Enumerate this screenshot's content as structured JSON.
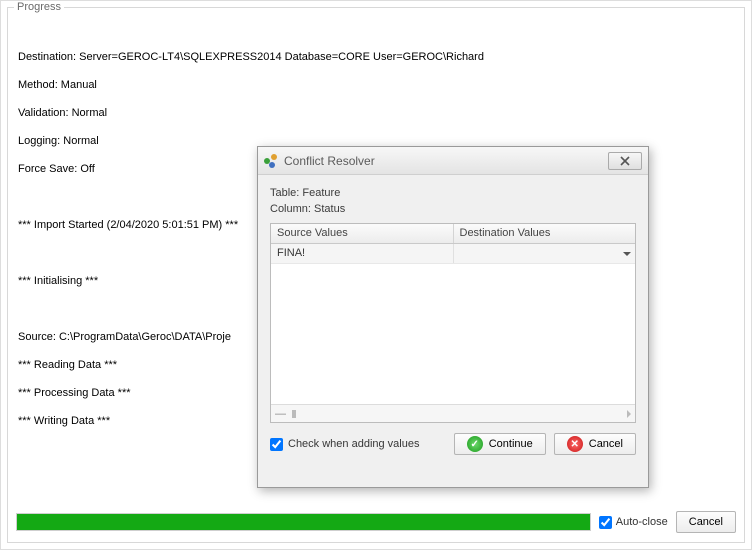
{
  "panel": {
    "title": "Progress"
  },
  "log": {
    "lines": [
      "Destination: Server=GEROC-LT4\\SQLEXPRESS2014 Database=CORE User=GEROC\\Richard",
      "Method: Manual",
      "Validation: Normal",
      "Logging: Normal",
      "Force Save: Off",
      "",
      "*** Import Started (2/04/2020 5:01:51 PM) ***",
      "",
      "*** Initialising ***",
      "",
      "Source: C:\\ProgramData\\Geroc\\DATA\\Proje",
      "*** Reading Data ***",
      "*** Processing Data ***",
      "*** Writing Data ***"
    ]
  },
  "dialog": {
    "title": "Conflict Resolver",
    "table_label": "Table: Feature",
    "column_label": "Column: Status",
    "headers": {
      "source": "Source Values",
      "destination": "Destination Values"
    },
    "rows": [
      {
        "source": "FINA!",
        "destination": ""
      }
    ],
    "check_label": "Check when adding values",
    "check_value": true,
    "continue_label": "Continue",
    "cancel_label": "Cancel"
  },
  "footer": {
    "autoclose_label": "Auto-close",
    "autoclose_value": true,
    "cancel_label": "Cancel",
    "progress_percent": 100
  }
}
